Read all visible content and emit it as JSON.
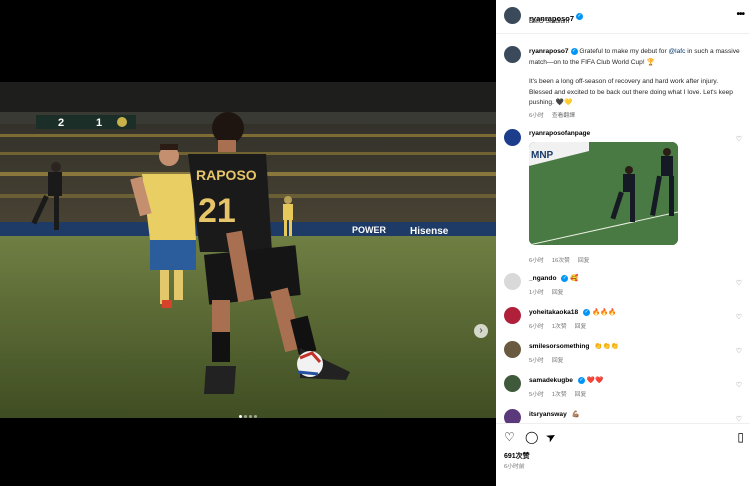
{
  "post": {
    "username": "ryanraposo7",
    "location": "BMO Stadium",
    "more_label": "•••"
  },
  "scoreboard": {
    "home": "2",
    "away": "1"
  },
  "jersey": {
    "name": "RAPOSO",
    "number": "21"
  },
  "photo_brands": {
    "ad1": "POWER",
    "ad2": "Hisense"
  },
  "carousel": {
    "next_icon": "›"
  },
  "caption": {
    "username": "ryanraposo7",
    "text_before": " Grateful to make my debut for ",
    "mention": "@lafc",
    "text_after": " in such a massive match—on to the FIFA Club World Cup! 🏆",
    "text2": "It's been a long off-season of recovery and hard work after injury. Blessed and excited to be back out there doing what I love. Let's keep pushing. 🖤💛",
    "time": "6小时",
    "translate": "查看翻譯"
  },
  "comments": [
    {
      "username": "ryanraposofanpage",
      "text": "",
      "time": "6小时",
      "likes": "16次赞",
      "reply": "回复",
      "image_text": "MNP"
    },
    {
      "username": "_ngando",
      "text": "🥰",
      "time": "1小时",
      "likes": "",
      "reply": "回复"
    },
    {
      "username": "yoheitakaoka18",
      "text": "🔥🔥🔥",
      "time": "6小时",
      "likes": "1次赞",
      "reply": "回复"
    },
    {
      "username": "smilesorsomething",
      "text": "👏👏👏",
      "time": "5小时",
      "likes": "",
      "reply": "回复"
    },
    {
      "username": "samadekugbe",
      "text": "❤️❤️",
      "time": "5小时",
      "likes": "1次赞",
      "reply": "回复"
    },
    {
      "username": "itsryansway",
      "text": "💪🏽",
      "time": "",
      "likes": "",
      "reply": ""
    }
  ],
  "actions": {
    "like_icon": "♡",
    "comment_icon": "◯",
    "share_icon": "➤",
    "save_icon": "▯",
    "likes": "691次赞",
    "time": "6小时前"
  },
  "colors": {
    "verified": "#0095f6",
    "mention": "#00376b",
    "muted": "#737373"
  }
}
